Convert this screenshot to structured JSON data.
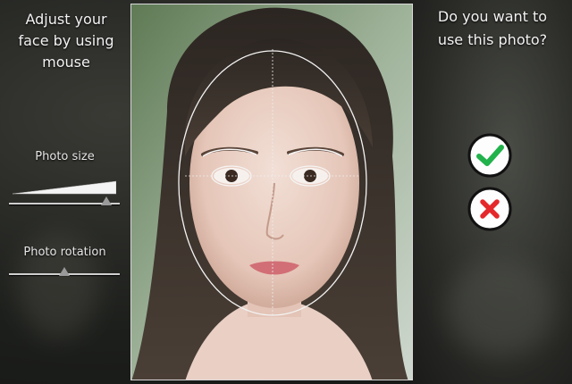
{
  "left_panel": {
    "instruction_line1": "Adjust your",
    "instruction_line2": "face by using",
    "instruction_line3": "mouse",
    "photo_size_label": "Photo size",
    "photo_size_level": 0.88,
    "photo_rotation_label": "Photo rotation",
    "photo_rotation_level": 0.5
  },
  "right_panel": {
    "question_line1": "Do you want to",
    "question_line2": "use this photo?",
    "confirm_icon": "checkmark-icon",
    "cancel_icon": "x-icon",
    "confirm_color": "#22b24c",
    "cancel_color": "#e5282b"
  },
  "photo": {
    "overlay": "face-oval-guide"
  }
}
